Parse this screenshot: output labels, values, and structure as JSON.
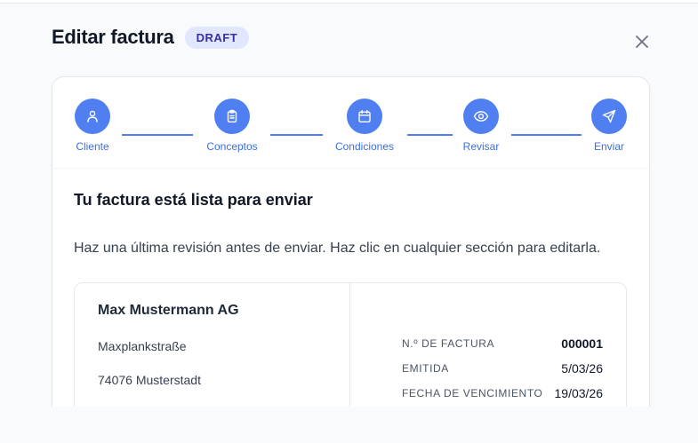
{
  "header": {
    "title": "Editar factura",
    "badge": "DRAFT"
  },
  "close_icon": "close-icon",
  "stepper": {
    "steps": [
      {
        "label": "Cliente",
        "icon": "user-icon"
      },
      {
        "label": "Conceptos",
        "icon": "clipboard-icon"
      },
      {
        "label": "Condiciones",
        "icon": "calendar-icon"
      },
      {
        "label": "Revisar",
        "icon": "eye-icon"
      },
      {
        "label": "Enviar",
        "icon": "send-icon"
      }
    ],
    "accent": "#4f7ff0"
  },
  "review": {
    "title": "Tu factura está lista para enviar",
    "description": "Haz una última revisión antes de enviar. Haz clic en cualquier sección para editarla."
  },
  "summary": {
    "company": "Max Mustermann AG",
    "street": "Maxplankstraße",
    "city": "74076 Musterstadt",
    "meta": [
      {
        "label": "N.º DE FACTURA",
        "value": "000001"
      },
      {
        "label": "EMITIDA",
        "value": "5/03/26"
      },
      {
        "label": "FECHA DE VENCIMIENTO",
        "value": "19/03/26"
      }
    ]
  }
}
